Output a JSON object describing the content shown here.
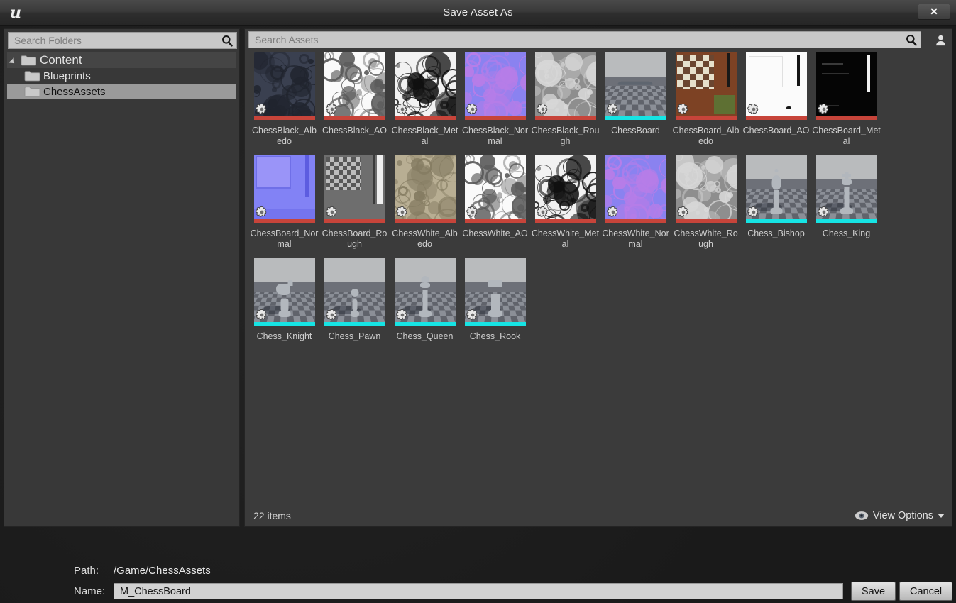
{
  "window": {
    "title": "Save Asset As",
    "logo": "unreal-engine-logo",
    "close_label": "✕"
  },
  "folder_panel": {
    "search": {
      "placeholder": "Search Folders",
      "icon": "search-icon"
    },
    "tree": [
      {
        "label": "Content",
        "depth": 0,
        "expanded": true,
        "selected": false
      },
      {
        "label": "Blueprints",
        "depth": 1,
        "expanded": false,
        "selected": false
      },
      {
        "label": "ChessAssets",
        "depth": 1,
        "expanded": false,
        "selected": true
      }
    ]
  },
  "asset_panel": {
    "search": {
      "placeholder": "Search Assets",
      "icon": "search-icon"
    },
    "user_icon": "user-icon",
    "status": {
      "items_text": "22 items",
      "view_options_label": "View Options",
      "view_options_icon": "eye-icon"
    },
    "colors": {
      "texture_bar": "#c7443a",
      "mesh_bar": "#16e4e4",
      "selection": "#9a9a9a"
    },
    "assets": [
      {
        "name": "ChessBlack_Albedo",
        "type": "texture",
        "art": "swirl-dark"
      },
      {
        "name": "ChessBlack_AO",
        "type": "texture",
        "art": "swirl-white"
      },
      {
        "name": "ChessBlack_Metal",
        "type": "texture",
        "art": "swirl-bw"
      },
      {
        "name": "ChessBlack_Normal",
        "type": "texture",
        "art": "swirl-normal"
      },
      {
        "name": "ChessBlack_Rough",
        "type": "texture",
        "art": "swirl-gray"
      },
      {
        "name": "ChessBoard",
        "type": "mesh",
        "art": "plane"
      },
      {
        "name": "ChessBoard_Albedo",
        "type": "texture",
        "art": "board-wood"
      },
      {
        "name": "ChessBoard_AO",
        "type": "texture",
        "art": "board-white"
      },
      {
        "name": "ChessBoard_Metal",
        "type": "texture",
        "art": "board-black"
      },
      {
        "name": "ChessBoard_Normal",
        "type": "texture",
        "art": "board-normal"
      },
      {
        "name": "ChessBoard_Rough",
        "type": "texture",
        "art": "board-rough"
      },
      {
        "name": "ChessWhite_Albedo",
        "type": "texture",
        "art": "swirl-tan"
      },
      {
        "name": "ChessWhite_AO",
        "type": "texture",
        "art": "swirl-white"
      },
      {
        "name": "ChessWhite_Metal",
        "type": "texture",
        "art": "swirl-bw"
      },
      {
        "name": "ChessWhite_Normal",
        "type": "texture",
        "art": "swirl-normal"
      },
      {
        "name": "ChessWhite_Rough",
        "type": "texture",
        "art": "swirl-gray"
      },
      {
        "name": "Chess_Bishop",
        "type": "mesh",
        "art": "piece-bishop"
      },
      {
        "name": "Chess_King",
        "type": "mesh",
        "art": "piece-king"
      },
      {
        "name": "Chess_Knight",
        "type": "mesh",
        "art": "piece-knight"
      },
      {
        "name": "Chess_Pawn",
        "type": "mesh",
        "art": "piece-pawn"
      },
      {
        "name": "Chess_Queen",
        "type": "mesh",
        "art": "piece-queen"
      },
      {
        "name": "Chess_Rook",
        "type": "mesh",
        "art": "piece-rook"
      }
    ]
  },
  "footer": {
    "path_label": "Path:",
    "path_value": "/Game/ChessAssets",
    "name_label": "Name:",
    "name_value": "M_ChessBoard",
    "save_label": "Save",
    "cancel_label": "Cancel"
  }
}
